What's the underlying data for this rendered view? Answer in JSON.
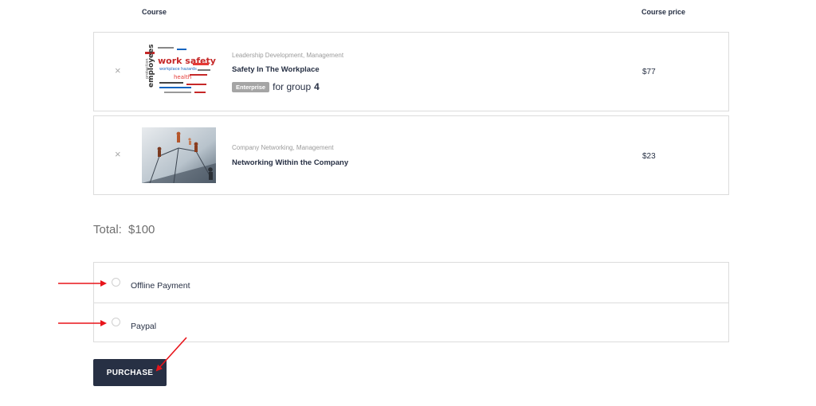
{
  "table": {
    "col_course": "Course",
    "col_price": "Course price"
  },
  "items": [
    {
      "remove": "×",
      "categories": "Leadership Development, Management",
      "title": "Safety In The Workplace",
      "badge": "Enterprise",
      "group_text": "for group",
      "group_size": "4",
      "price": "$77",
      "thumb_words": [
        "work safety",
        "workplace hazards",
        "employees",
        "protection",
        "health"
      ]
    },
    {
      "remove": "×",
      "categories": "Company Networking, Management",
      "title": "Networking Within the Company",
      "price": "$23"
    }
  ],
  "total": {
    "label": "Total:",
    "value": "$100"
  },
  "payment": {
    "options": [
      {
        "label": "Offline Payment"
      },
      {
        "label": "Paypal"
      }
    ]
  },
  "purchase_label": "PURCHASE",
  "colors": {
    "primary": "#273044",
    "border": "#dcdcdc",
    "annotation_arrow": "#e8141a"
  }
}
